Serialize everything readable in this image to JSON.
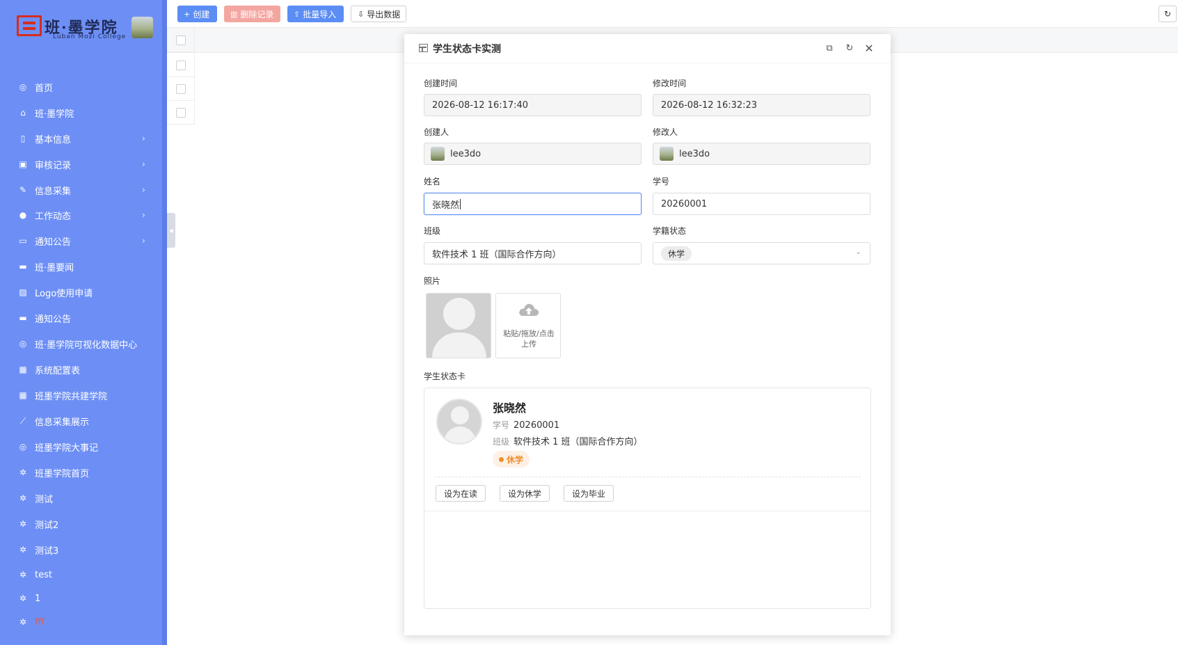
{
  "sidebar": {
    "logo_title": "班·墨学院",
    "logo_subtitle": "Luban Mozi College",
    "items": [
      {
        "icon": "globe-icon",
        "glyph": "◎",
        "label": "首页",
        "has_arrow": false
      },
      {
        "icon": "home-icon",
        "glyph": "⌂",
        "label": "班·墨学院",
        "has_arrow": false
      },
      {
        "icon": "book-icon",
        "glyph": "▯",
        "label": "基本信息",
        "has_arrow": true
      },
      {
        "icon": "briefcase-icon",
        "glyph": "▣",
        "label": "审核记录",
        "has_arrow": true
      },
      {
        "icon": "pencil-icon",
        "glyph": "✎",
        "label": "信息采集",
        "has_arrow": true
      },
      {
        "icon": "upload-circle-icon",
        "glyph": "●",
        "label": "工作动态",
        "has_arrow": true
      },
      {
        "icon": "message-icon",
        "glyph": "▭",
        "label": "通知公告",
        "has_arrow": true
      },
      {
        "icon": "chat-icon",
        "glyph": "▬",
        "label": "班·墨要闻",
        "has_arrow": false
      },
      {
        "icon": "image-check-icon",
        "glyph": "▨",
        "label": "Logo使用申请",
        "has_arrow": false
      },
      {
        "icon": "chat-icon",
        "glyph": "▬",
        "label": "通知公告",
        "has_arrow": false
      },
      {
        "icon": "globe-icon",
        "glyph": "◎",
        "label": "班·墨学院可视化数据中心",
        "has_arrow": false
      },
      {
        "icon": "table-icon",
        "glyph": "▦",
        "label": "系统配置表",
        "has_arrow": false
      },
      {
        "icon": "table-icon",
        "glyph": "▦",
        "label": "班墨学院共建学院",
        "has_arrow": false
      },
      {
        "icon": "line-chart-icon",
        "glyph": "⟋",
        "label": "信息采集展示",
        "has_arrow": false
      },
      {
        "icon": "globe-icon",
        "glyph": "◎",
        "label": "班墨学院大事记",
        "has_arrow": false
      },
      {
        "icon": "bug-icon",
        "glyph": "✲",
        "label": "班墨学院首页",
        "has_arrow": false
      },
      {
        "icon": "bug-icon",
        "glyph": "✲",
        "label": "测试",
        "has_arrow": false
      },
      {
        "icon": "bug-icon",
        "glyph": "✲",
        "label": "测试2",
        "has_arrow": false
      },
      {
        "icon": "bug-icon",
        "glyph": "✲",
        "label": "测试3",
        "has_arrow": false
      },
      {
        "icon": "bug-icon",
        "glyph": "✲",
        "label": "test",
        "has_arrow": false
      },
      {
        "icon": "bug-icon",
        "glyph": "✲",
        "label": "1",
        "has_arrow": false
      },
      {
        "icon": "bug-icon",
        "glyph": "✲",
        "label": "fff",
        "has_arrow": false,
        "red": true
      }
    ]
  },
  "toolbar": {
    "create": "创建",
    "delete": "删除记录",
    "import": "批量导入",
    "export": "导出数据"
  },
  "modal": {
    "title": "学生状态卡实测",
    "fields": {
      "created_at": {
        "label": "创建时间",
        "value": "2026-08-12 16:17:40"
      },
      "updated_at": {
        "label": "修改时间",
        "value": "2026-08-12 16:32:23"
      },
      "creator": {
        "label": "创建人",
        "value": "lee3do"
      },
      "modifier": {
        "label": "修改人",
        "value": "lee3do"
      },
      "name": {
        "label": "姓名",
        "value": "张晓然"
      },
      "student_id": {
        "label": "学号",
        "value": "20260001"
      },
      "class": {
        "label": "班级",
        "value": "软件技术 1 班（国际合作方向）"
      },
      "status": {
        "label": "学籍状态",
        "value": "休学"
      },
      "photo": {
        "label": "照片",
        "upload_line1": "粘贴/拖放/点击",
        "upload_line2": "上传"
      }
    },
    "card": {
      "section_label": "学生状态卡",
      "name": "张晓然",
      "id_key": "学号",
      "id_value": "20260001",
      "class_key": "班级",
      "class_value": "软件技术 1 班（国际合作方向）",
      "status": "休学",
      "status_color": "#f08c2a",
      "btn_active": "设为在读",
      "btn_suspend": "设为休学",
      "btn_graduate": "设为毕业"
    }
  },
  "colors": {
    "sidebar_bg": "#6d8ff5",
    "primary": "#5b8df4",
    "danger_light": "#f3a6a0"
  }
}
